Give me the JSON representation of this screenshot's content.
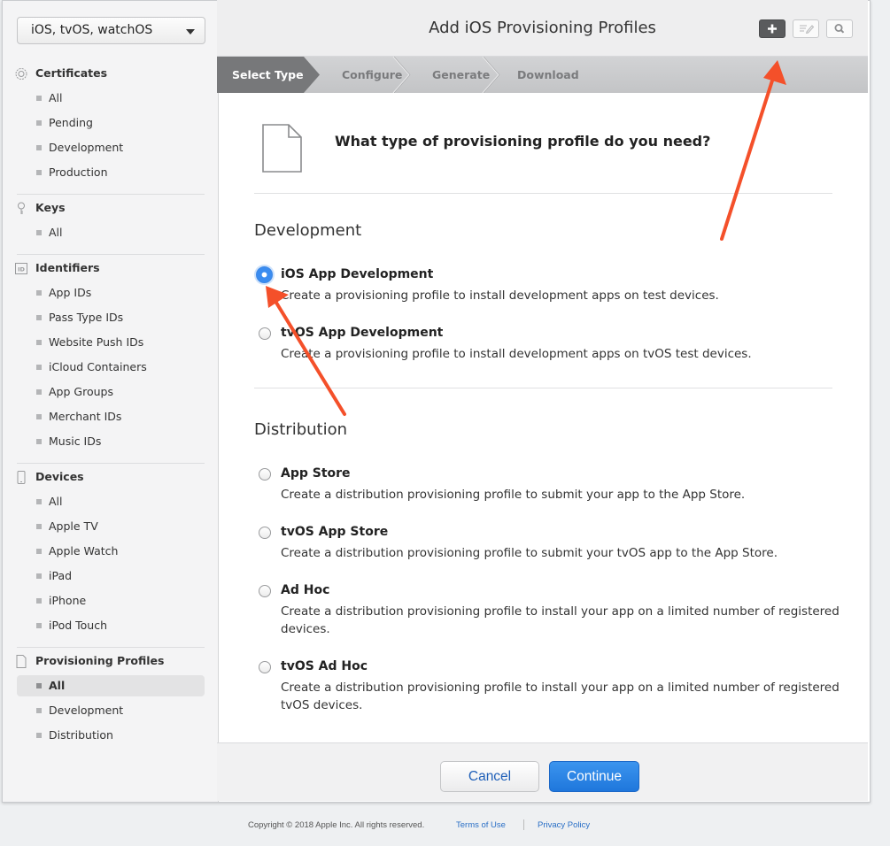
{
  "platform_select": {
    "value": "iOS, tvOS, watchOS"
  },
  "sidebar": {
    "sections": [
      {
        "title": "Certificates",
        "icon": "certificate-icon",
        "items": [
          "All",
          "Pending",
          "Development",
          "Production"
        ]
      },
      {
        "title": "Keys",
        "icon": "key-icon",
        "items": [
          "All"
        ]
      },
      {
        "title": "Identifiers",
        "icon": "id-icon",
        "items": [
          "App IDs",
          "Pass Type IDs",
          "Website Push IDs",
          "iCloud Containers",
          "App Groups",
          "Merchant IDs",
          "Music IDs"
        ]
      },
      {
        "title": "Devices",
        "icon": "device-icon",
        "items": [
          "All",
          "Apple TV",
          "Apple Watch",
          "iPad",
          "iPhone",
          "iPod Touch"
        ]
      },
      {
        "title": "Provisioning Profiles",
        "icon": "document-icon",
        "items": [
          "All",
          "Development",
          "Distribution"
        ]
      }
    ],
    "active_item": "Provisioning Profiles / All"
  },
  "header": {
    "title": "Add iOS Provisioning Profiles"
  },
  "toolbar": {
    "icons": [
      "plus-icon",
      "edit-icon",
      "search-icon"
    ]
  },
  "steps": [
    "Select Type",
    "Configure",
    "Generate",
    "Download"
  ],
  "current_step": "Select Type",
  "question": "What type of provisioning profile do you need?",
  "groups": [
    {
      "title": "Development",
      "options": [
        {
          "label": "iOS App Development",
          "desc": "Create a provisioning profile to install development apps on test devices.",
          "checked": true
        },
        {
          "label": "tvOS App Development",
          "desc": "Create a provisioning profile to install development apps on tvOS test devices.",
          "checked": false
        }
      ]
    },
    {
      "title": "Distribution",
      "options": [
        {
          "label": "App Store",
          "desc": "Create a distribution provisioning profile to submit your app to the App Store.",
          "checked": false
        },
        {
          "label": "tvOS App Store",
          "desc": "Create a distribution provisioning profile to submit your tvOS app to the App Store.",
          "checked": false
        },
        {
          "label": "Ad Hoc",
          "desc": "Create a distribution provisioning profile to install your app on a limited number of registered devices.",
          "checked": false
        },
        {
          "label": "tvOS Ad Hoc",
          "desc": "Create a distribution provisioning profile to install your app on a limited number of registered tvOS devices.",
          "checked": false
        }
      ]
    }
  ],
  "buttons": {
    "cancel": "Cancel",
    "continue": "Continue"
  },
  "footer": {
    "copyright": "Copyright © 2018 Apple Inc. All rights reserved.",
    "terms": "Terms of Use",
    "privacy": "Privacy Policy"
  },
  "colors": {
    "accent": "#1f77dc",
    "annotation_arrow": "#f4502a",
    "step_active": "#77787a"
  }
}
